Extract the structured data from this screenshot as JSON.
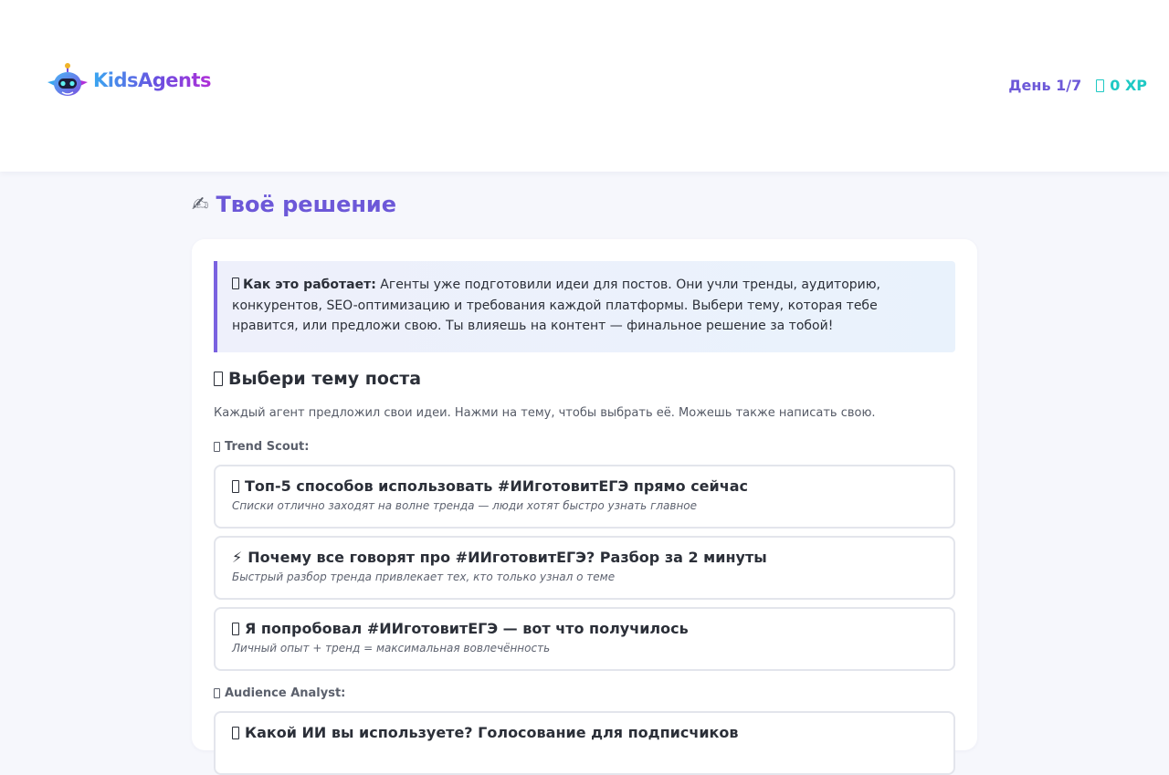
{
  "header": {
    "brand": "KidsAgents",
    "day_label": "День 1/7",
    "xp_label": "0 XP"
  },
  "page": {
    "heading_icon": "✍",
    "heading": "Твоё решение"
  },
  "info_box": {
    "label": "Как это работает:",
    "text": " Агенты уже подготовили идеи для постов. Они учли тренды, аудиторию, конкурентов, SEO-оптимизацию и требования каждой платформы. Выбери тему, которая тебе нравится, или предложи свою. Ты влияешь на контент — финальное решение за тобой!"
  },
  "topics_section": {
    "title": "Выбери тему поста",
    "subtitle": "Каждый агент предложил свои идеи. Нажми на тему, чтобы выбрать её. Можешь также написать свою.",
    "agents": [
      {
        "name": "Trend Scout:",
        "topics": [
          {
            "icon": "box",
            "title": "Топ-5 способов использовать #ИИготовитЕГЭ прямо сейчас",
            "desc": "Списки отлично заходят на волне тренда — люди хотят быстро узнать главное"
          },
          {
            "icon": "⚡",
            "title": "Почему все говорят про #ИИготовитЕГЭ? Разбор за 2 минуты",
            "desc": "Быстрый разбор тренда привлекает тех, кто только узнал о теме"
          },
          {
            "icon": "box",
            "title": "Я попробовал #ИИготовитЕГЭ — вот что получилось",
            "desc": "Личный опыт + тренд = максимальная вовлечённость"
          }
        ]
      },
      {
        "name": "Audience Analyst:",
        "topics": [
          {
            "icon": "box",
            "title": "Какой ИИ вы используете? Голосование для подписчиков",
            "desc": ""
          }
        ]
      }
    ]
  },
  "colors": {
    "accent": "#6c58d8",
    "xp": "#1ec9c4",
    "info_border": "#7a62e0",
    "background": "#f6f7fc"
  }
}
